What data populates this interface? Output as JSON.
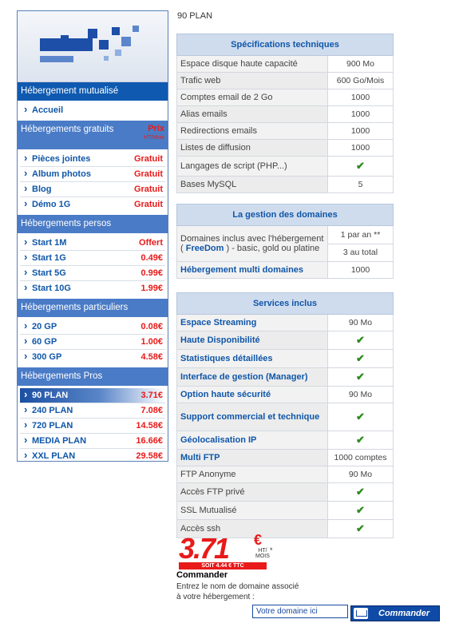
{
  "plan_title": "90 PLAN",
  "sidebar": {
    "sections": [
      {
        "title": "Hébergement mutualisé",
        "items": [
          {
            "label": "Accueil",
            "price": ""
          }
        ]
      },
      {
        "title": "Hébergements gratuits",
        "prix": "Prix",
        "prix_unit": "HT/Mois",
        "items": [
          {
            "label": "Pièces jointes",
            "price": "Gratuit"
          },
          {
            "label": "Album photos",
            "price": "Gratuit"
          },
          {
            "label": "Blog",
            "price": "Gratuit"
          },
          {
            "label": "Démo 1G",
            "price": "Gratuit"
          }
        ]
      },
      {
        "title": "Hébergements persos",
        "items": [
          {
            "label": "Start 1M",
            "price": "Offert"
          },
          {
            "label": "Start 1G",
            "price": "0.49€"
          },
          {
            "label": "Start 5G",
            "price": "0.99€"
          },
          {
            "label": "Start 10G",
            "price": "1.99€"
          }
        ]
      },
      {
        "title": "Hébergements particuliers",
        "items": [
          {
            "label": "20 GP",
            "price": "0.08€"
          },
          {
            "label": "60 GP",
            "price": "1.00€"
          },
          {
            "label": "300 GP",
            "price": "4.58€"
          }
        ]
      },
      {
        "title": "Hébergements Pros",
        "items": [
          {
            "label": "90 PLAN",
            "price": "3.71€",
            "active": true
          },
          {
            "label": "240 PLAN",
            "price": "7.08€"
          },
          {
            "label": "720 PLAN",
            "price": "14.58€"
          },
          {
            "label": "MEDIA PLAN",
            "price": "16.66€"
          },
          {
            "label": "XXL PLAN",
            "price": "29.58€"
          }
        ]
      }
    ]
  },
  "specs": {
    "title": "Spécifications techniques",
    "rows": [
      {
        "label": "Espace disque haute capacité",
        "value": "900 Mo"
      },
      {
        "label": "Trafic web",
        "value": "600 Go/Mois"
      },
      {
        "label": "Comptes email de 2 Go",
        "value": "1000"
      },
      {
        "label": "Alias emails",
        "value": "1000"
      },
      {
        "label": "Redirections emails",
        "value": "1000"
      },
      {
        "label": "Listes de diffusion",
        "value": "1000"
      },
      {
        "label": "Langages de script (PHP...)",
        "value": "check"
      },
      {
        "label": "Bases MySQL",
        "value": "5"
      }
    ]
  },
  "domains": {
    "title": "La gestion des domaines",
    "row1_label_pre": "Domaines inclus avec l'hébergement ( ",
    "row1_label_link": "FreeDom",
    "row1_label_post": " ) - basic, gold ou platine",
    "row1_value_a": "1 par an **",
    "row1_value_b": "3 au total",
    "row2_label": "Hébergement multi domaines",
    "row2_value": "1000"
  },
  "services": {
    "title": "Services inclus",
    "rows": [
      {
        "label": "Espace Streaming",
        "value": "90 Mo",
        "blue": true
      },
      {
        "label": "Haute Disponibilité",
        "value": "check",
        "blue": true
      },
      {
        "label": "Statistiques détaillées",
        "value": "check",
        "blue": true
      },
      {
        "label": "Interface de gestion (Manager)",
        "value": "check",
        "blue": true
      },
      {
        "label": "Option haute sécurité",
        "value": "90 Mo",
        "blue": true
      },
      {
        "label": "Support commercial et technique",
        "value": "check",
        "blue": true
      },
      {
        "label": "Géolocalisation IP",
        "value": "check",
        "blue": true
      },
      {
        "label": "Multi FTP",
        "value": "1000 comptes",
        "blue": true
      },
      {
        "label": "FTP Anonyme",
        "value": "90 Mo",
        "blue": false
      },
      {
        "label": "Accès FTP privé",
        "value": "check",
        "blue": false
      },
      {
        "label": "SSL Mutualisé",
        "value": "check",
        "blue": false
      },
      {
        "label": "Accès ssh",
        "value": "check",
        "blue": false
      }
    ]
  },
  "price": {
    "amount": "3.71",
    "currency": "€",
    "unit_line1": "HT/",
    "unit_line2": "MOIS",
    "star": "*",
    "ttc": "SOIT 4.44 € TTC"
  },
  "order": {
    "title": "Commander",
    "text": "Entrez le nom de domaine associé à votre hébergement :",
    "input_value": "Votre domaine ici",
    "button_label": "Commander"
  },
  "colors": {
    "accent_blue": "#0f56a8",
    "price_red": "#e81a1a",
    "check_green": "#2d8b1e"
  }
}
